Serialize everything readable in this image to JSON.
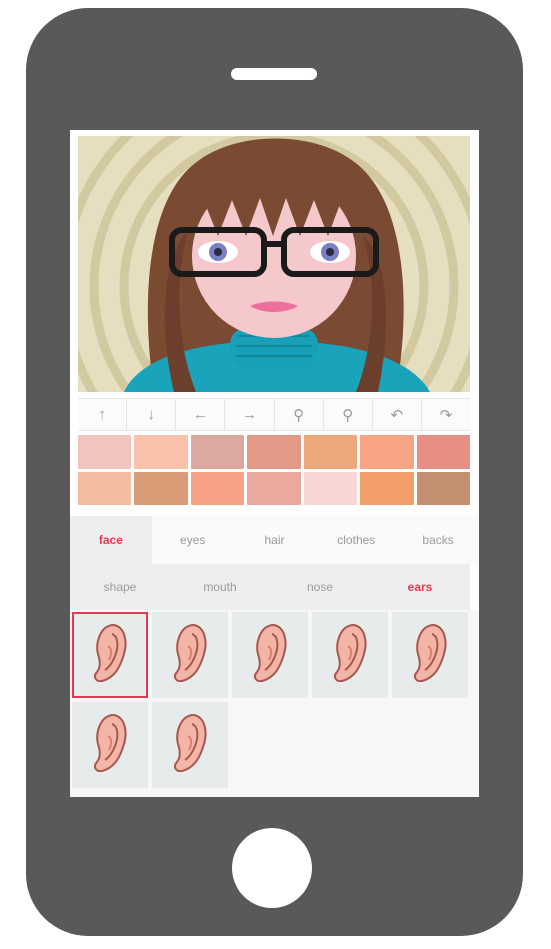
{
  "colors": {
    "phone_body": "#595959",
    "accent": "#e8384f",
    "tab_active_bg": "#eceeef"
  },
  "toolbar": {
    "tools": [
      {
        "icon": "arrow-up-icon",
        "glyph": "↑"
      },
      {
        "icon": "arrow-down-icon",
        "glyph": "↓"
      },
      {
        "icon": "arrow-left-icon",
        "glyph": "←"
      },
      {
        "icon": "arrow-right-icon",
        "glyph": "→"
      },
      {
        "icon": "zoom-out-icon",
        "glyph": "⚲"
      },
      {
        "icon": "zoom-in-icon",
        "glyph": "⚲"
      },
      {
        "icon": "undo-icon",
        "glyph": "↶"
      },
      {
        "icon": "redo-icon",
        "glyph": "↷"
      }
    ]
  },
  "palette": [
    "#f3c3bf",
    "#f9c1aa",
    "#dba9a0",
    "#e29a86",
    "#eda77d",
    "#f6a484",
    "#e88f84",
    "#f2bd9e",
    "#d99b75",
    "#f7a286",
    "#eba99d",
    "#f7d7d3",
    "#f39e69",
    "#c3906f"
  ],
  "tabs": {
    "items": [
      {
        "label": "face"
      },
      {
        "label": "eyes"
      },
      {
        "label": "hair"
      },
      {
        "label": "clothes"
      },
      {
        "label": "backs"
      }
    ],
    "active_index": 0
  },
  "subtabs": {
    "items": [
      {
        "label": "shape"
      },
      {
        "label": "mouth"
      },
      {
        "label": "nose"
      },
      {
        "label": "ears"
      }
    ],
    "active_index": 3
  },
  "ear_options": {
    "count": 7,
    "selected_index": 0,
    "icon": "ear-icon"
  }
}
